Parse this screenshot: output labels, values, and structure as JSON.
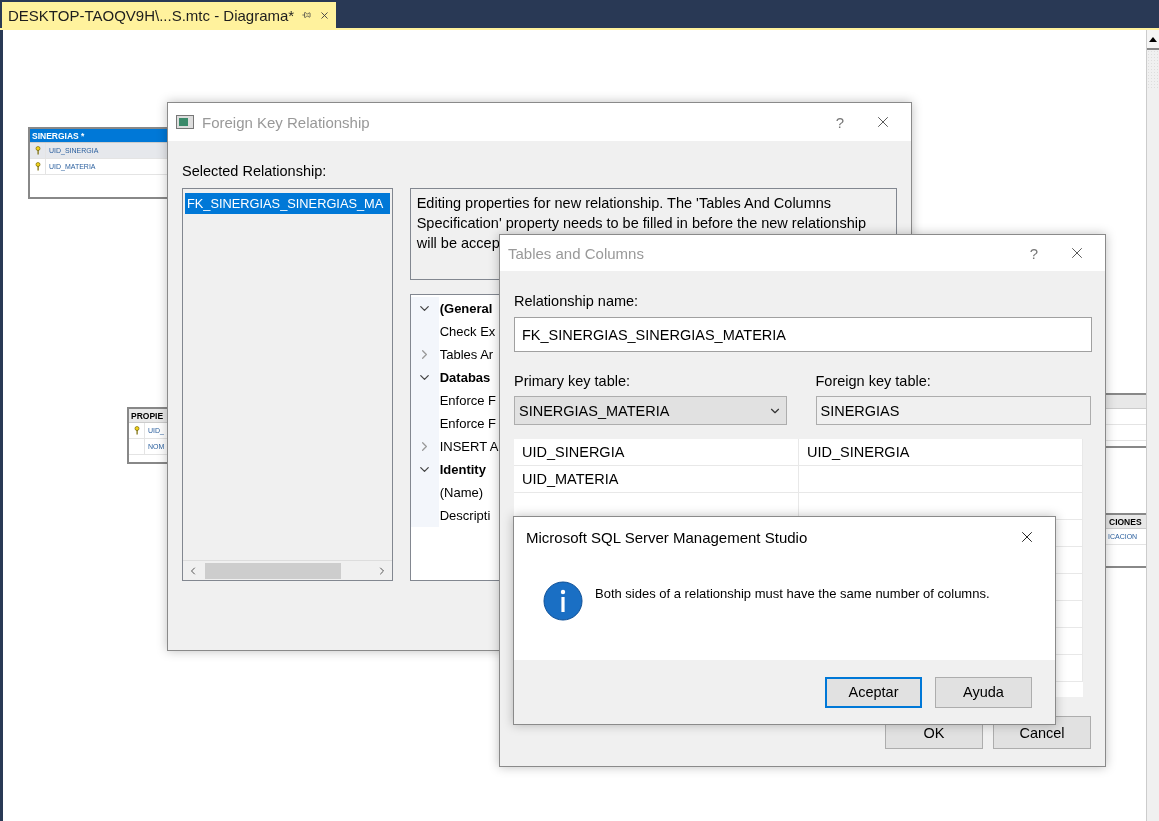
{
  "document_tab": {
    "title": "DESKTOP-TAOQV9H\\...S.mtc - Diagrama*"
  },
  "diagram_tables": [
    {
      "title": "SINERGIAS *",
      "selected": true,
      "columns": [
        {
          "name": "UID_SINERGIA",
          "key": true,
          "selected": true
        },
        {
          "name": "UID_MATERIA",
          "key": true,
          "selected": false
        }
      ]
    },
    {
      "title": "PROPIE",
      "selected": false,
      "columns": [
        {
          "name": "UID_",
          "key": true,
          "selected": false
        },
        {
          "name": "NOM",
          "key": false,
          "selected": false
        }
      ]
    },
    {
      "selected": false
    },
    {
      "title": "CIONES",
      "selected": false,
      "columns": [
        {
          "name": "ICACION",
          "selected": false
        }
      ]
    }
  ],
  "fk_dialog": {
    "title": "Foreign Key Relationship",
    "help": "?",
    "selected_label": "Selected Relationship:",
    "relationships": [
      {
        "name": "FK_SINERGIAS_SINERGIAS_MA",
        "selected": true
      }
    ],
    "description_lines": [
      "Editing properties for new relationship.  The 'Tables And Columns",
      "Specification' property needs to be filled in before the new relationship",
      "will be accep"
    ],
    "properties": [
      {
        "label": "(General",
        "expanded": true,
        "children": [
          {
            "label": "Check Ex"
          },
          {
            "label": "Tables Ar",
            "expanded": false
          }
        ]
      },
      {
        "label": "Databas",
        "expanded": true,
        "children": [
          {
            "label": "Enforce F"
          },
          {
            "label": "Enforce F"
          },
          {
            "label": "INSERT A",
            "expanded": false
          }
        ]
      },
      {
        "label": "Identity",
        "expanded": true,
        "children": [
          {
            "label": "(Name)"
          },
          {
            "label": "Descripti"
          }
        ]
      }
    ]
  },
  "tables_dialog": {
    "title": "Tables and Columns",
    "help": "?",
    "name_label": "Relationship name:",
    "name_value": "FK_SINERGIAS_SINERGIAS_MATERIA",
    "primary_label": "Primary key table:",
    "primary_value": "SINERGIAS_MATERIA",
    "foreign_label": "Foreign key table:",
    "foreign_value": "SINERGIAS",
    "column_rows": [
      {
        "primary": "UID_SINERGIA",
        "foreign": "UID_SINERGIA"
      },
      {
        "primary": "UID_MATERIA"
      }
    ],
    "buttons": [
      "OK",
      "Cancel"
    ]
  },
  "message_box": {
    "title": "Microsoft SQL Server Management Studio",
    "message": "Both sides of a relationship must have the same number of columns.",
    "buttons": [
      {
        "label": "Aceptar",
        "default": true
      },
      {
        "label": "Ayuda",
        "default": false
      }
    ]
  }
}
